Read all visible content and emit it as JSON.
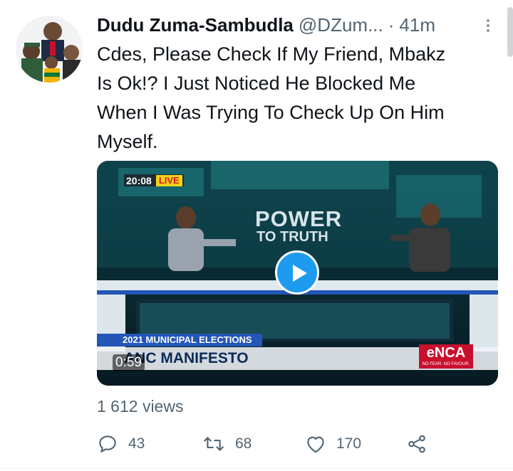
{
  "tweet": {
    "author_name": "Dudu Zuma-Sambudla",
    "handle": "@DZum...",
    "separator": "·",
    "time": "41m",
    "text_lines": [
      "Cdes, Please Check If My Friend, Mbakz",
      "Is Ok!? I Just Noticed He Blocked Me",
      "When I Was Trying To Check Up On Him",
      "Myself."
    ]
  },
  "video": {
    "timestamp": "20:08",
    "live_label": "LIVE",
    "show_title": "POWER",
    "show_subtitle": "TO TRUTH",
    "ticker": "2021 MUNICIPAL ELECTIONS",
    "headline": "ANC MANIFESTO",
    "duration": "0:59",
    "channel_logo": "eNCA",
    "channel_tagline": "NO FEAR. NO FAVOUR."
  },
  "stats": {
    "views": "1 612 views"
  },
  "actions": {
    "replies": "43",
    "retweets": "68",
    "likes": "170"
  },
  "icons": [
    "more-icon",
    "reply-icon",
    "retweet-icon",
    "like-icon",
    "share-icon",
    "play-icon"
  ],
  "colors": {
    "accent": "#1d9bf0",
    "secondary_text": "#536471",
    "live_badge": "#f7d117",
    "channel_red": "#c8102e"
  }
}
